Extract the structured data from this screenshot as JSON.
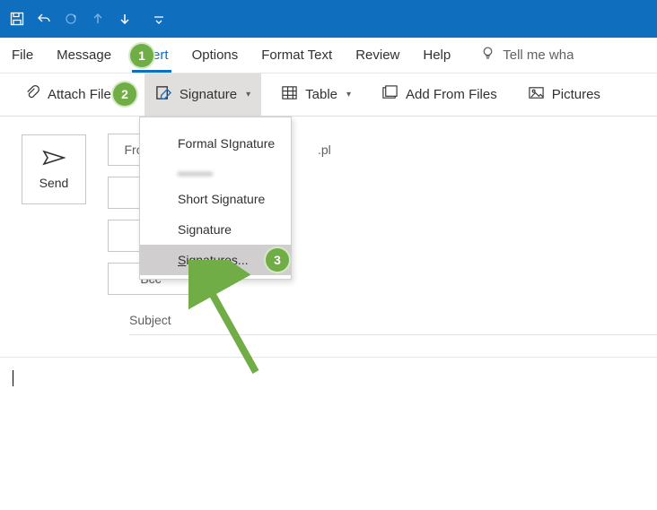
{
  "titlebar": {
    "icons": [
      "save-icon",
      "undo-icon",
      "redo-icon",
      "arrow-up-icon",
      "arrow-down-icon",
      "customize-icon"
    ]
  },
  "menu": {
    "file": "File",
    "message": "Message",
    "insert": "Insert",
    "options": "Options",
    "format_text": "Format Text",
    "review": "Review",
    "help": "Help",
    "tell_me": "Tell me wha"
  },
  "ribbon": {
    "attach_file": "Attach File",
    "signature": "Signature",
    "table": "Table",
    "add_from_files": "Add From Files",
    "pictures": "Pictures"
  },
  "dropdown": {
    "items": [
      "Formal SIgnature",
      "Short Signature",
      "Signature",
      "Signatures..."
    ]
  },
  "compose": {
    "send": "Send",
    "from_label": "Fro",
    "from_value_suffix": ".pl",
    "to_label": "",
    "cc_label": "",
    "bcc_label": "Bcc",
    "subject_label": "Subject"
  },
  "badges": {
    "one": "1",
    "two": "2",
    "three": "3"
  }
}
